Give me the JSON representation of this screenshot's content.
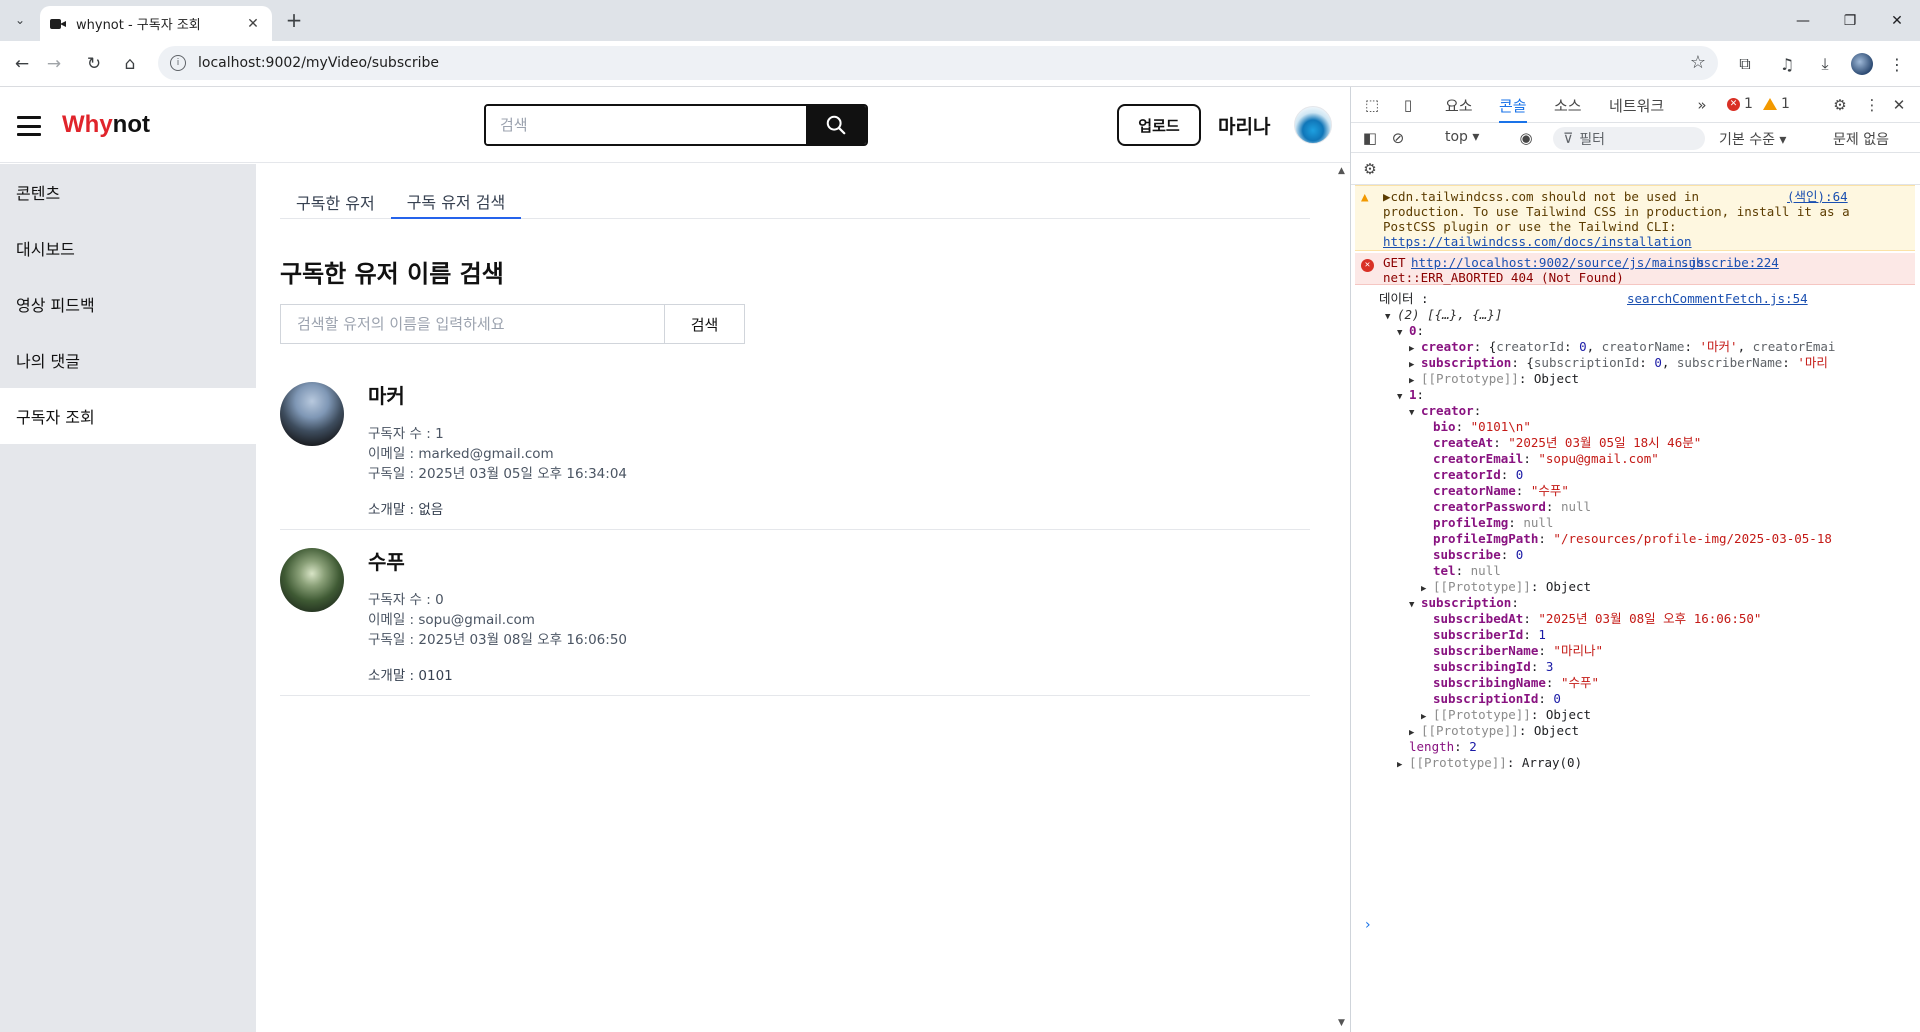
{
  "browser": {
    "tab_title": "whynot - 구독자 조회",
    "url": "localhost:9002/myVideo/subscribe"
  },
  "app": {
    "logo_red": "Why",
    "logo_black": "not",
    "search_placeholder": "검색",
    "upload_label": "업로드",
    "username": "마리나"
  },
  "sidebar": {
    "items": [
      {
        "label": "콘텐츠"
      },
      {
        "label": "대시보드"
      },
      {
        "label": "영상 피드백"
      },
      {
        "label": "나의 댓글"
      },
      {
        "label": "구독자 조회"
      }
    ]
  },
  "main": {
    "tabs": [
      {
        "label": "구독한 유저"
      },
      {
        "label": "구독 유저 검색"
      }
    ],
    "title": "구독한 유저 이름 검색",
    "search_placeholder": "검색할 유저의 이름을 입력하세요",
    "search_button": "검색",
    "results": [
      {
        "name": "마커",
        "subscribers": "구독자 수 : 1",
        "email": "이메일 : marked@gmail.com",
        "subscribed": "구독일 : 2025년 03월 05일 오후 16:34:04",
        "bio": "소개말 : 없음"
      },
      {
        "name": "수푸",
        "subscribers": "구독자 수 : 0",
        "email": "이메일 : sopu@gmail.com",
        "subscribed": "구독일 : 2025년 03월 08일 오후 16:06:50",
        "bio": "소개말 : 0101"
      }
    ]
  },
  "devtools": {
    "tabs": [
      "요소",
      "콘솔",
      "소스",
      "네트워크"
    ],
    "error_count": "1",
    "warn_count": "1",
    "context": "top",
    "filter_placeholder": "필터",
    "level": "기본 수준",
    "issues": "문제 없음",
    "warn": {
      "line1": "cdn.tailwindcss.com should not be used in",
      "line2": "production. To use Tailwind CSS in production, install it as a",
      "line3": "PostCSS plugin or use the Tailwind CLI:",
      "link": "https://tailwindcss.com/docs/installation",
      "source": "(색인):64"
    },
    "error": {
      "method": "GET",
      "url": "http://localhost:9002/source/js/main.js",
      "source": "subscribe:224",
      "line2": "net::ERR_ABORTED 404 (Not Found)"
    },
    "log": {
      "label": "데이터 :",
      "source": "searchCommentFetch.js:54",
      "summary": "(2) [{…}, {…}]"
    }
  }
}
